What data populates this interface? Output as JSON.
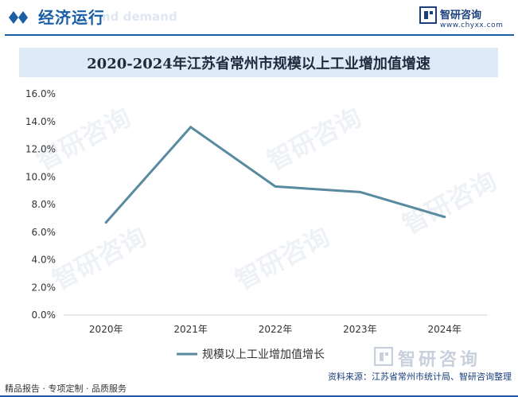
{
  "header": {
    "section_title": "经济运行",
    "ghost_text": "nd demand",
    "logo_text": "智研咨询",
    "logo_url": "www.chyxx.com"
  },
  "chart_data": {
    "type": "line",
    "title": "2020-2024年江苏省常州市规模以上工业增加值增速",
    "categories": [
      "2020年",
      "2021年",
      "2022年",
      "2023年",
      "2024年"
    ],
    "series": [
      {
        "name": "规模以上工业增加值增长",
        "values": [
          6.7,
          13.6,
          9.3,
          8.9,
          7.1
        ],
        "color": "#5a8aa0"
      }
    ],
    "ylim": [
      0,
      16
    ],
    "y_ticks": [
      "0.0%",
      "2.0%",
      "4.0%",
      "6.0%",
      "8.0%",
      "10.0%",
      "12.0%",
      "14.0%",
      "16.0%"
    ],
    "grid": false,
    "legend": "bottom"
  },
  "watermark": {
    "text": "智研咨询"
  },
  "footer": {
    "left": "精品报告 · 专项定制 · 品质服务",
    "source": "资料来源：江苏省常州市统计局、智研咨询整理",
    "logo_text": "智研咨询"
  }
}
